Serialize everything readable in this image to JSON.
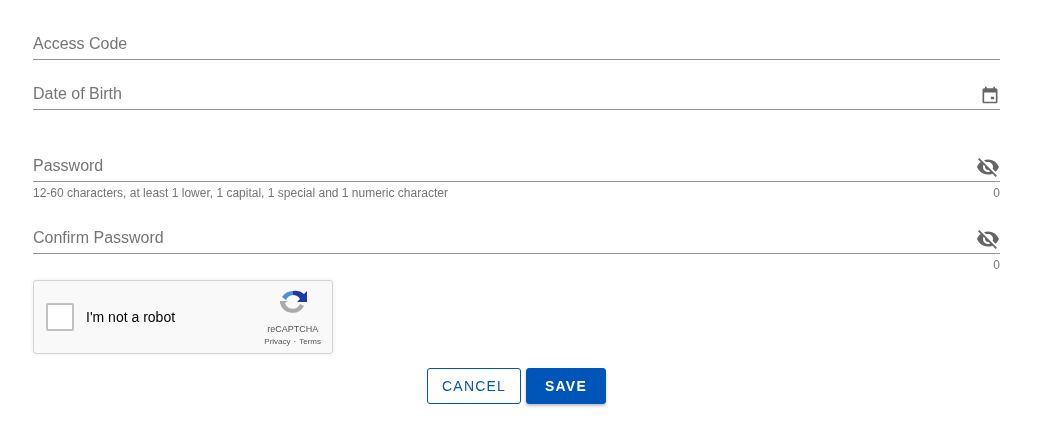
{
  "fields": [
    {
      "kind": "text",
      "placeholder": "Access Code"
    },
    {
      "kind": "date",
      "placeholder": "Date of Birth"
    },
    {
      "kind": "password",
      "placeholder": "Password",
      "hint": "12-60 characters, at least 1 lower, 1 capital, 1 special and 1 numeric character",
      "counter": "0"
    },
    {
      "kind": "password",
      "placeholder": "Confirm Password",
      "counter": "0"
    }
  ],
  "captcha": {
    "checked": false,
    "label": "I'm not a robot",
    "brand": "reCAPTCHA",
    "links": [
      "Privacy",
      "Terms"
    ],
    "separator": "·"
  },
  "buttons": [
    {
      "kind": "outlined",
      "label": "CANCEL"
    },
    {
      "kind": "filled",
      "label": "SAVE"
    }
  ]
}
